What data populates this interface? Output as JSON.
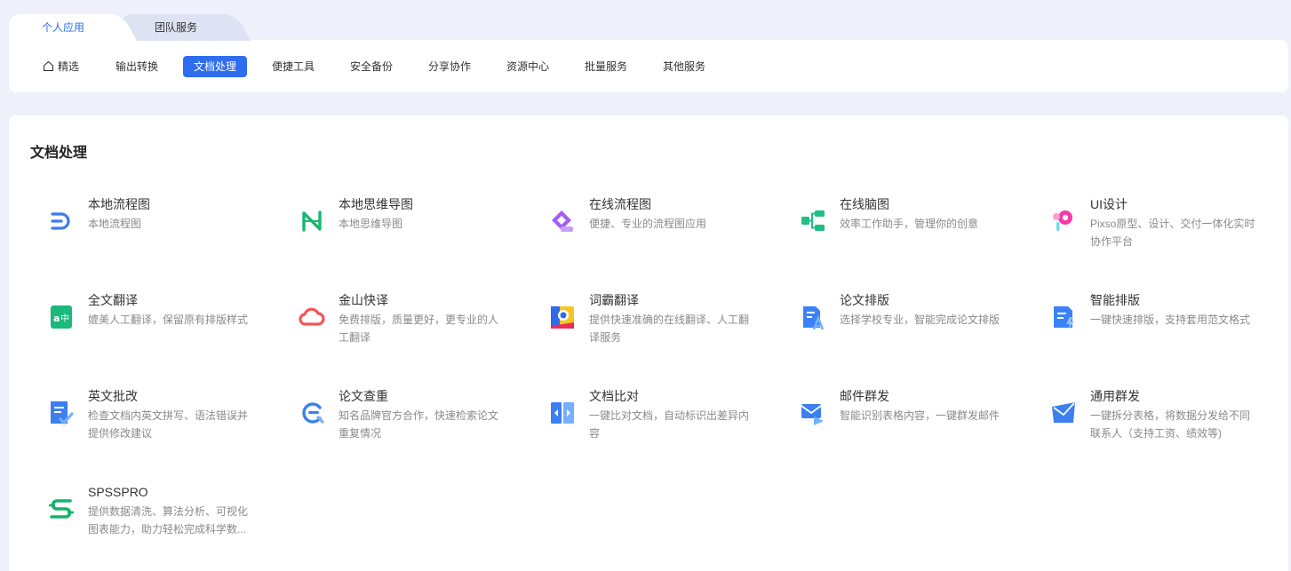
{
  "top_tabs": [
    {
      "label": "个人应用",
      "active": true
    },
    {
      "label": "团队服务",
      "active": false
    }
  ],
  "subnav": [
    {
      "label": "精选",
      "icon": "home-icon"
    },
    {
      "label": "输出转换"
    },
    {
      "label": "文档处理",
      "active": true
    },
    {
      "label": "便捷工具"
    },
    {
      "label": "安全备份"
    },
    {
      "label": "分享协作"
    },
    {
      "label": "资源中心"
    },
    {
      "label": "批量服务"
    },
    {
      "label": "其他服务"
    }
  ],
  "section": {
    "title": "文档处理"
  },
  "apps": [
    {
      "name": "本地流程图",
      "desc": "本地流程图",
      "icon": "local-flowchart-icon"
    },
    {
      "name": "本地思维导图",
      "desc": "本地思维导图",
      "icon": "local-mindmap-icon"
    },
    {
      "name": "在线流程图",
      "desc": "便捷、专业的流程图应用",
      "icon": "online-flowchart-icon"
    },
    {
      "name": "在线脑图",
      "desc": "效率工作助手，管理你的创意",
      "icon": "online-mindmap-icon"
    },
    {
      "name": "UI设计",
      "desc": "Pixso原型、设计、交付一体化实时协作平台",
      "icon": "ui-design-icon"
    },
    {
      "name": "全文翻译",
      "desc": "媲美人工翻译，保留原有排版样式",
      "icon": "full-translate-icon"
    },
    {
      "name": "金山快译",
      "desc": "免费排版，质量更好，更专业的人工翻译",
      "icon": "kingsoft-translate-icon"
    },
    {
      "name": "词霸翻译",
      "desc": "提供快速准确的在线翻译、人工翻译服务",
      "icon": "iciba-translate-icon"
    },
    {
      "name": "论文排版",
      "desc": "选择学校专业，智能完成论文排版",
      "icon": "thesis-format-icon"
    },
    {
      "name": "智能排版",
      "desc": "一键快速排版，支持套用范文格式",
      "icon": "smart-format-icon"
    },
    {
      "name": "英文批改",
      "desc": "检查文档内英文拼写、语法错误并提供修改建议",
      "icon": "english-correction-icon"
    },
    {
      "name": "论文查重",
      "desc": "知名品牌官方合作，快速检索论文重复情况",
      "icon": "plagiarism-check-icon"
    },
    {
      "name": "文档比对",
      "desc": "一键比对文档，自动标识出差异内容",
      "icon": "doc-compare-icon"
    },
    {
      "name": "邮件群发",
      "desc": "智能识别表格内容，一键群发邮件",
      "icon": "mail-merge-icon"
    },
    {
      "name": "通用群发",
      "desc": "一键拆分表格，将数据分发给不同联系人（支持工资、绩效等)",
      "icon": "general-send-icon"
    },
    {
      "name": "SPSSPRO",
      "desc": "提供数据清洗、算法分析、可视化图表能力，助力轻松完成科学数...",
      "icon": "spsspro-icon"
    }
  ]
}
